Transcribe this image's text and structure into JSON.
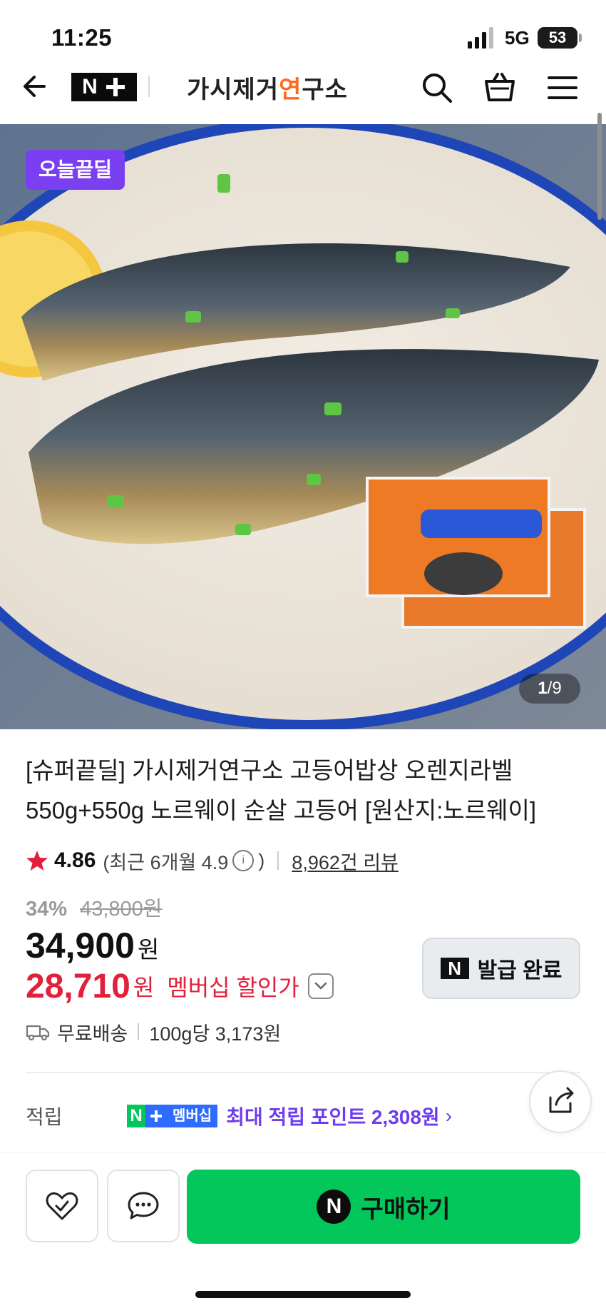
{
  "status_bar": {
    "time": "11:25",
    "network": "5G",
    "battery": "53"
  },
  "header": {
    "nplus_label": "N",
    "store_logo_left": "가시제거",
    "store_logo_accent": "연",
    "store_logo_right": "구소"
  },
  "gallery": {
    "badge": "오늘끝딜",
    "current": "1",
    "separator": "/",
    "total": "9"
  },
  "product": {
    "title": "[슈퍼끝딜] 가시제거연구소 고등어밥상 오렌지라벨 550g+550g 노르웨이 순살 고등어 [원산지:노르웨이]",
    "rating": "4.86",
    "recent_rating_prefix": "(최근 6개월 4.9",
    "recent_rating_suffix": ")",
    "review_count": "8,962건 리뷰",
    "discount_pct": "34%",
    "original_price": "43,800원",
    "price": "34,900",
    "price_unit": "원",
    "member_price": "28,710",
    "member_price_unit": "원",
    "member_price_label": "멤버십 할인가",
    "coupon_button": "발급 완료",
    "delivery": "무료배송",
    "unit_price": "100g당 3,173원"
  },
  "points": {
    "label": "적립",
    "badge_n": "N",
    "badge_member": "멤버십",
    "max_points": "최대 적립 포인트 2,308원"
  },
  "bottom": {
    "buy_icon": "N",
    "buy_label": "구매하기"
  },
  "colors": {
    "accent_red": "#e2203c",
    "naver_green": "#03c75a",
    "points_purple": "#6e3cf0",
    "badge_purple": "#7b3ff2"
  }
}
